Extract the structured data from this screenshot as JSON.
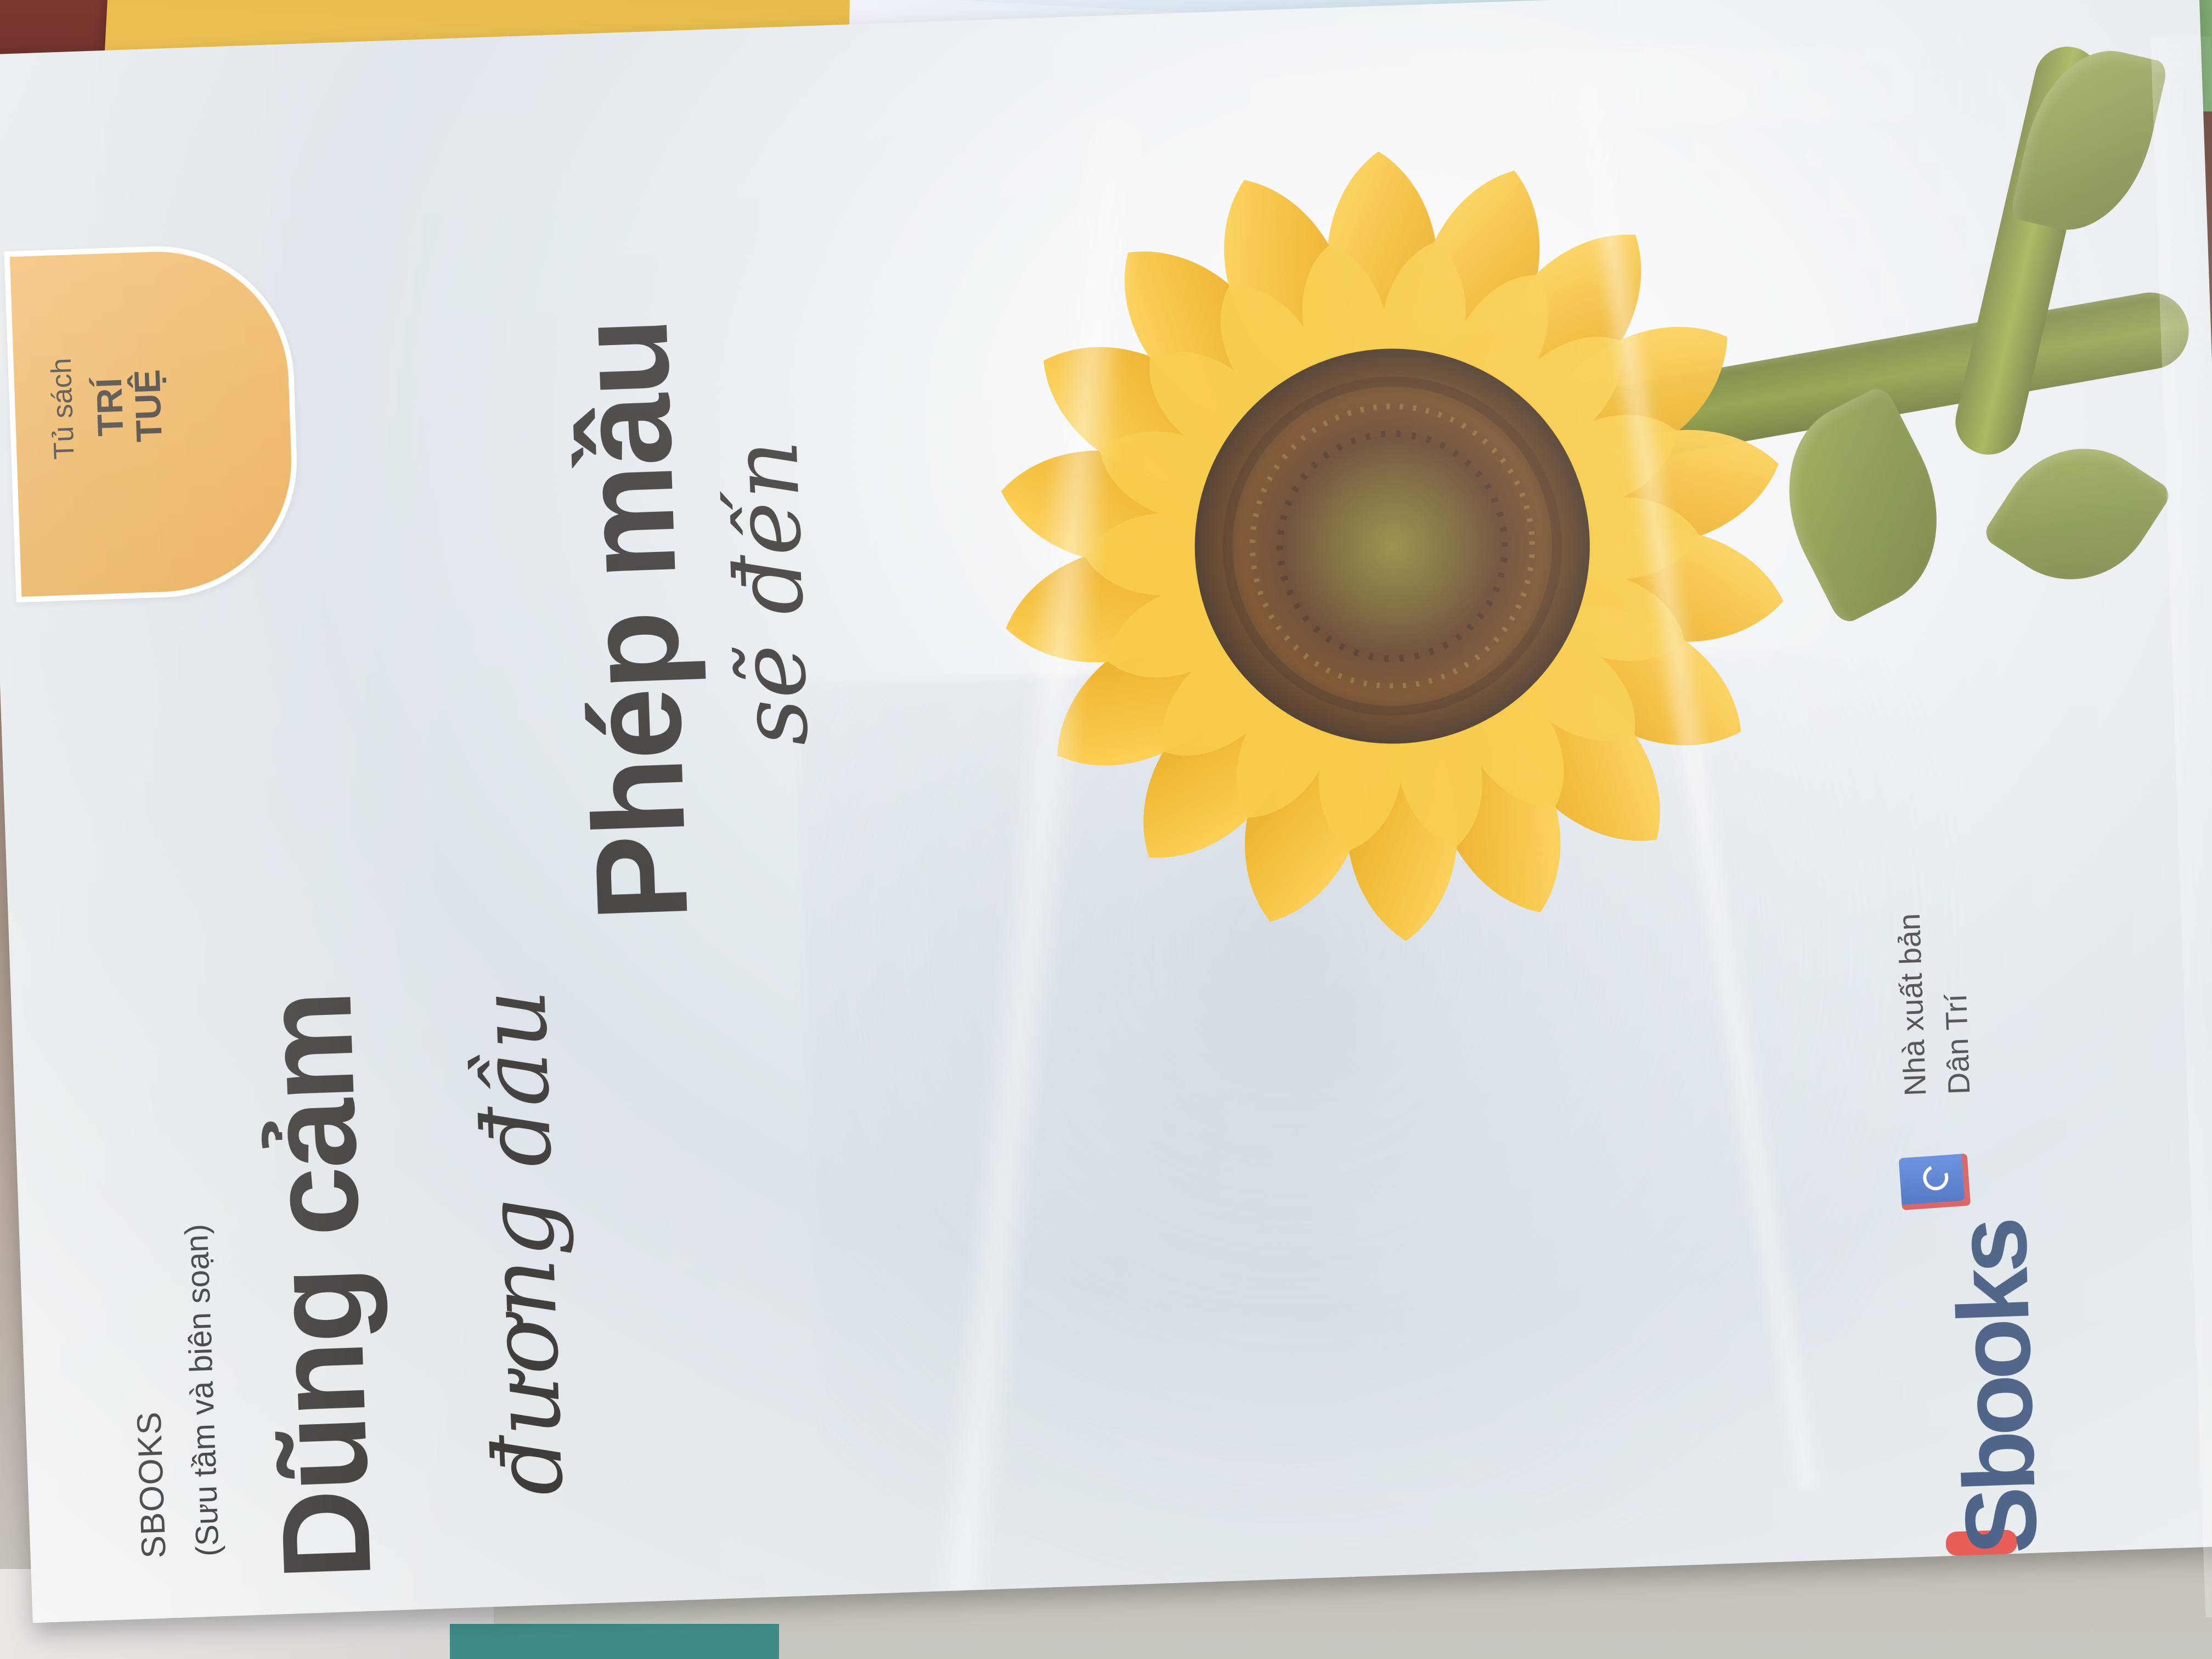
{
  "series": {
    "label": "Tủ sách",
    "name": "TRÍ TUỆ"
  },
  "author": {
    "name": "SBOOKS",
    "note": "(Sưu tầm và biên soạn)"
  },
  "title": {
    "line1": "Dũng cảm",
    "line2": "đương đầu",
    "line3": "Phép mầu",
    "line4": "sẽ đến"
  },
  "publisher": {
    "line1": "Nhà xuất bản",
    "line2": "Dân Trí"
  },
  "brand": {
    "logo_text": "Sbooks"
  }
}
